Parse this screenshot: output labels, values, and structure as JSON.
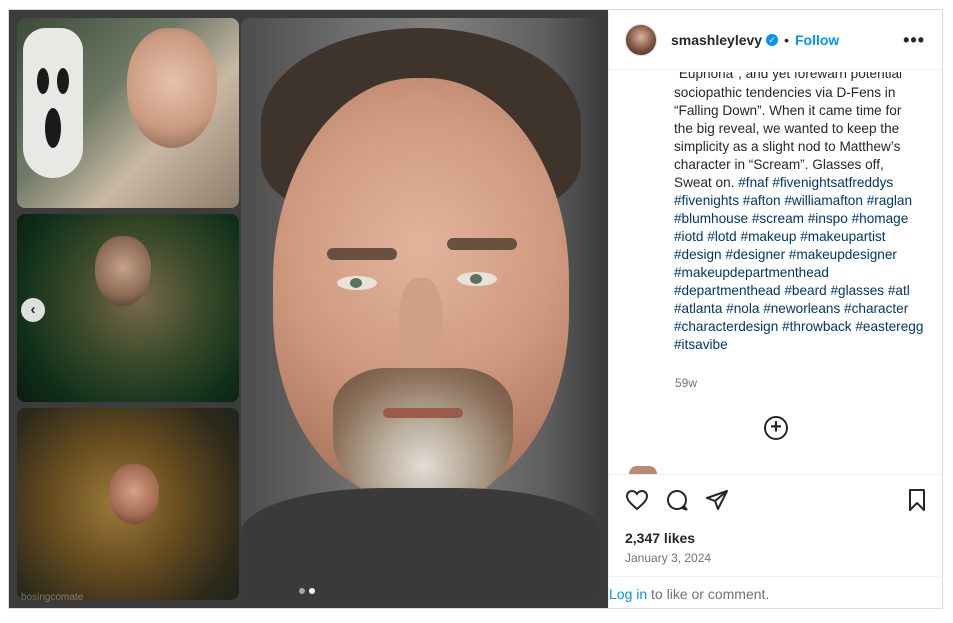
{
  "post": {
    "username": "smashleylevy",
    "follow_label": "Follow",
    "separator": "•",
    "more_label": "•••",
    "caption_lines": [
      "\"Euphoria\", and yet forewarn potential",
      "sociopathic tendencies via D-Fens in",
      "“Falling Down”. When it came time for",
      "the big reveal, we wanted to keep the",
      "simplicity as a slight nod to Matthew’s",
      "character in “Scream”. Glasses off,"
    ],
    "caption_tail": "Sweat on.",
    "hashtags": "#fnaf #fivenightsatfreddys #fivenights #afton #williamafton #raglan #blumhouse #scream #inspo #homage #iotd #lotd #makeup #makeupartist #design #designer #makeupdesigner #makeupdepartmenthead #departmenthead #beard #glasses #atl #atlanta #nola #neworleans #character #characterdesign #throwback #easteregg #itsavibe",
    "age": "59w",
    "likes": "2,347 likes",
    "date": "January 3, 2024",
    "login_link": "Log in",
    "login_rest": " to like or comment."
  },
  "media": {
    "prev_arrow": "‹",
    "watermark": "bosingcomate",
    "slide_count": 2,
    "active_slide": 2
  },
  "icons": {
    "verified": "verified-badge-icon",
    "like": "heart-icon",
    "comment": "comment-icon",
    "share": "share-icon",
    "save": "bookmark-icon",
    "add_comment": "plus-circle-icon"
  },
  "colors": {
    "link_blue": "#0095f6",
    "hashtag": "#00376b",
    "text": "#262626",
    "muted": "#737373"
  }
}
